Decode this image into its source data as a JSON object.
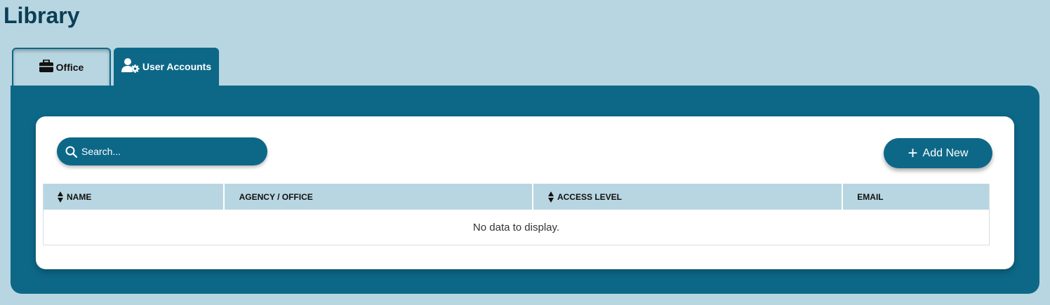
{
  "page": {
    "title": "Library"
  },
  "tabs": [
    {
      "label": "Office",
      "icon": "briefcase-icon",
      "active": false
    },
    {
      "label": "User Accounts",
      "icon": "user-gear-icon",
      "active": true
    }
  ],
  "search": {
    "placeholder": "Search...",
    "value": ""
  },
  "toolbar": {
    "add_label": "Add New"
  },
  "grid": {
    "columns": [
      {
        "label": "NAME",
        "sortable": true
      },
      {
        "label": "AGENCY / OFFICE",
        "sortable": false
      },
      {
        "label": "ACCESS LEVEL",
        "sortable": true
      },
      {
        "label": "EMAIL",
        "sortable": false
      }
    ],
    "empty_text": "No data to display."
  },
  "colors": {
    "background": "#b8d6e1",
    "primary": "#0d6888",
    "title": "#0b3e55",
    "header_row": "#b8d6e1"
  }
}
